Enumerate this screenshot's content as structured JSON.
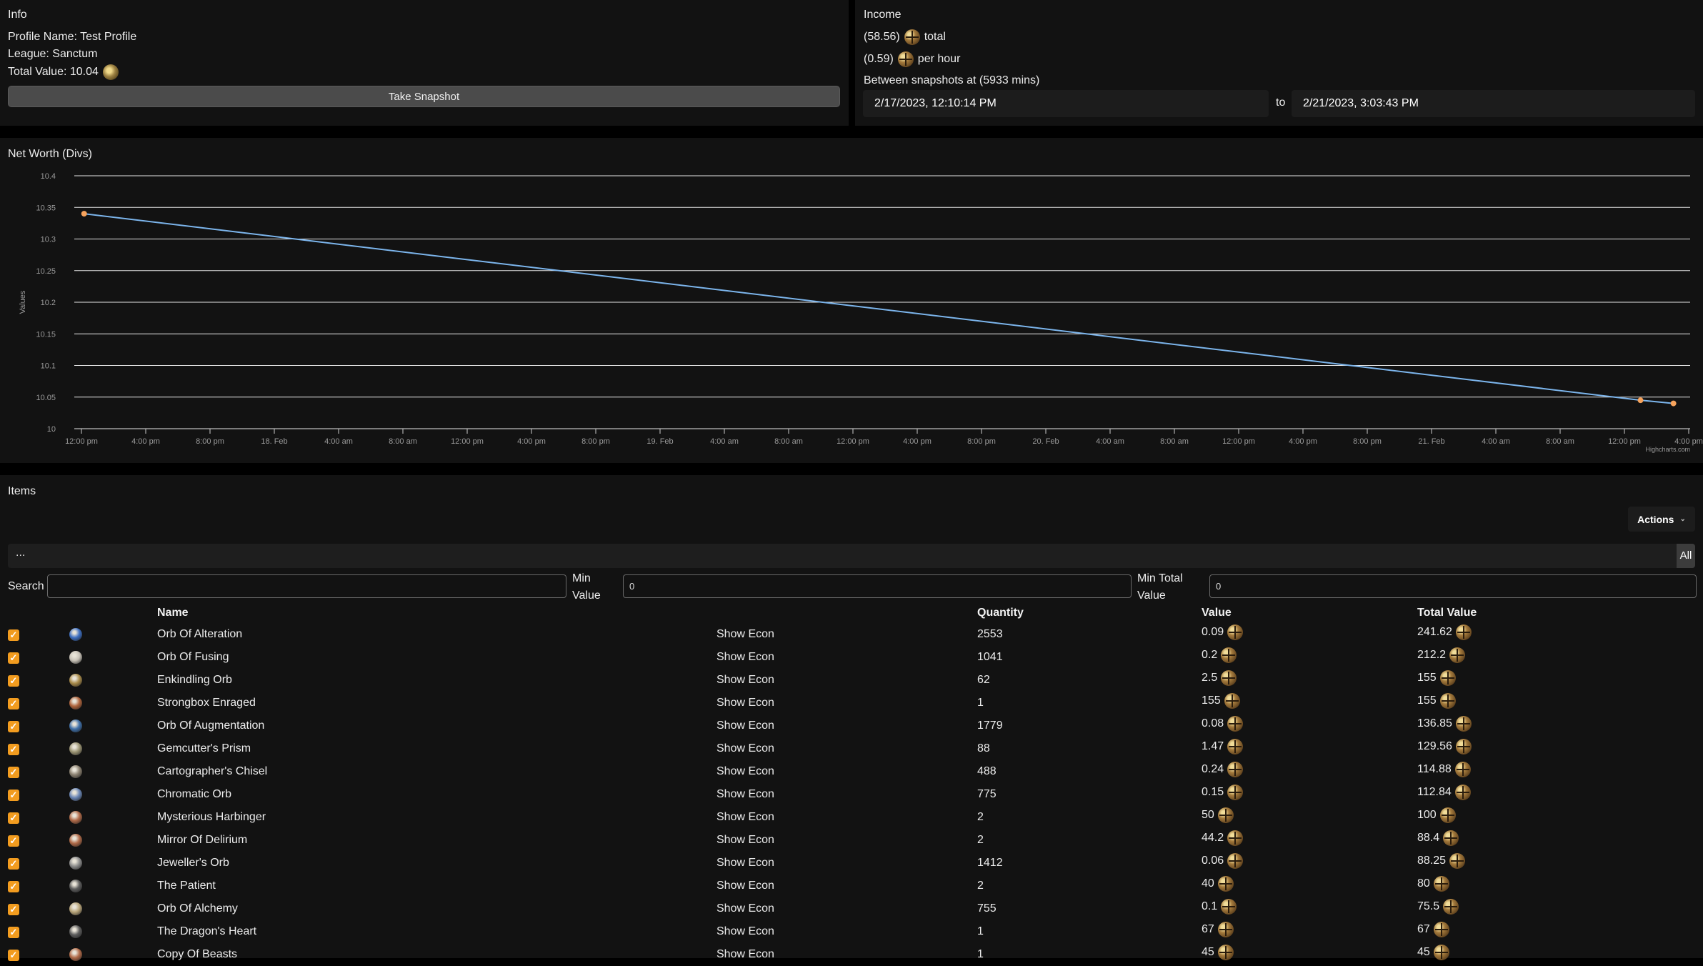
{
  "info": {
    "title": "Info",
    "profile_name": "Profile Name: Test Profile",
    "league": "League: Sanctum",
    "total_value": "Total Value: 10.04",
    "snapshot_button": "Take Snapshot"
  },
  "income": {
    "title": "Income",
    "total_amount": "(58.56)",
    "total_suffix": "total",
    "hour_amount": "(0.59)",
    "hour_suffix": "per hour",
    "between": "Between snapshots at (5933 mins)",
    "from_date": "2/17/2023, 12:10:14 PM",
    "to_label": "to",
    "to_date": "2/21/2023, 3:03:43 PM"
  },
  "chart_data": {
    "type": "line",
    "title": "Net Worth (Divs)",
    "xlabel": "",
    "ylabel": "Values",
    "ylim": [
      10,
      10.4
    ],
    "yticks": [
      "10.4",
      "10.35",
      "10.3",
      "10.25",
      "10.2",
      "10.15",
      "10.1",
      "10.05",
      "10"
    ],
    "xticks": [
      "12:00 pm",
      "4:00 pm",
      "8:00 pm",
      "18. Feb",
      "4:00 am",
      "8:00 am",
      "12:00 pm",
      "4:00 pm",
      "8:00 pm",
      "19. Feb",
      "4:00 am",
      "8:00 am",
      "12:00 pm",
      "4:00 pm",
      "8:00 pm",
      "20. Feb",
      "4:00 am",
      "8:00 am",
      "12:00 pm",
      "4:00 pm",
      "8:00 pm",
      "21. Feb",
      "4:00 am",
      "8:00 am",
      "12:00 pm",
      "4:00 pm"
    ],
    "x_start": "2023-02-17 12:00",
    "x_tick_step_hours": 4,
    "grid": true,
    "series": [
      {
        "points": [
          {
            "x": "2023-02-17 12:10",
            "y": 10.34
          },
          {
            "x": "2023-02-21 13:00",
            "y": 10.045
          },
          {
            "x": "2023-02-21 15:03",
            "y": 10.04
          }
        ]
      }
    ],
    "credit": "Highcharts.com",
    "colors": {
      "line": "#7cb5ec",
      "marker": "#f7a35c",
      "grid": "#e6e6e6"
    }
  },
  "items": {
    "title": "Items",
    "actions_label": "Actions",
    "filter_text": "...",
    "all_label": "All",
    "search_label": "Search",
    "search_value": "",
    "min_value_label": "Min Value",
    "min_value": "0",
    "min_total_label": "Min Total Value",
    "min_total": "0",
    "columns": {
      "name": "Name",
      "quantity": "Quantity",
      "value": "Value",
      "total": "Total Value"
    },
    "rows": [
      {
        "name": "Orb Of Alteration",
        "econ": "Show Econ",
        "qty": "2553",
        "value": "0.09",
        "total": "241.62",
        "icon": "#3d6fc2"
      },
      {
        "name": "Orb Of Fusing",
        "econ": "Show Econ",
        "qty": "1041",
        "value": "0.2",
        "total": "212.2",
        "icon": "#c9c3b8"
      },
      {
        "name": "Enkindling Orb",
        "econ": "Show Econ",
        "qty": "62",
        "value": "2.5",
        "total": "155",
        "icon": "#a98b4a"
      },
      {
        "name": "Strongbox Enraged",
        "econ": "Show Econ",
        "qty": "1",
        "value": "155",
        "total": "155",
        "icon": "#b0643c"
      },
      {
        "name": "Orb Of Augmentation",
        "econ": "Show Econ",
        "qty": "1779",
        "value": "0.08",
        "total": "136.85",
        "icon": "#3e6fa8"
      },
      {
        "name": "Gemcutter's Prism",
        "econ": "Show Econ",
        "qty": "88",
        "value": "1.47",
        "total": "129.56",
        "icon": "#9c9574"
      },
      {
        "name": "Cartographer's Chisel",
        "econ": "Show Econ",
        "qty": "488",
        "value": "0.24",
        "total": "114.88",
        "icon": "#8a8070"
      },
      {
        "name": "Chromatic Orb",
        "econ": "Show Econ",
        "qty": "775",
        "value": "0.15",
        "total": "112.84",
        "icon": "#6a86b6"
      },
      {
        "name": "Mysterious Harbinger",
        "econ": "Show Econ",
        "qty": "2",
        "value": "50",
        "total": "100",
        "icon": "#b06a48"
      },
      {
        "name": "Mirror Of Delirium",
        "econ": "Show Econ",
        "qty": "2",
        "value": "44.2",
        "total": "88.4",
        "icon": "#b06a48"
      },
      {
        "name": "Jeweller's Orb",
        "econ": "Show Econ",
        "qty": "1412",
        "value": "0.06",
        "total": "88.25",
        "icon": "#8d8d8d"
      },
      {
        "name": "The Patient",
        "econ": "Show Econ",
        "qty": "2",
        "value": "40",
        "total": "80",
        "icon": "#5c5c5c"
      },
      {
        "name": "Orb Of Alchemy",
        "econ": "Show Econ",
        "qty": "755",
        "value": "0.1",
        "total": "75.5",
        "icon": "#b8a57a"
      },
      {
        "name": "The Dragon's Heart",
        "econ": "Show Econ",
        "qty": "1",
        "value": "67",
        "total": "67",
        "icon": "#5c5c5c"
      },
      {
        "name": "Copy Of Beasts",
        "econ": "Show Econ",
        "qty": "1",
        "value": "45",
        "total": "45",
        "icon": "#b06a48"
      }
    ]
  }
}
